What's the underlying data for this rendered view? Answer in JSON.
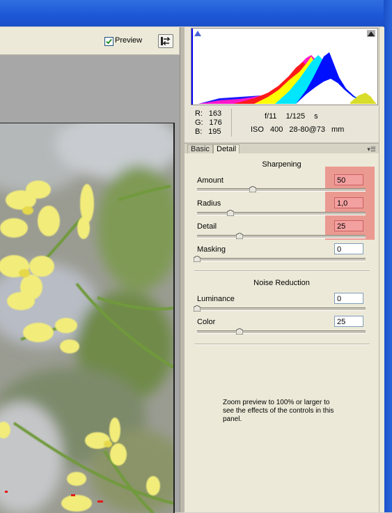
{
  "toolbar": {
    "preview_label": "Preview",
    "preview_checked": true,
    "toggle_icon": "swap-arrows-icon"
  },
  "readout": {
    "r_label": "R:",
    "r_value": "163",
    "g_label": "G:",
    "g_value": "176",
    "b_label": "B:",
    "b_value": "195",
    "aperture": "f/11",
    "shutter": "1/125 s",
    "iso": "ISO 400",
    "lens": "28-80@73 mm"
  },
  "tabs": [
    {
      "label": "Basic",
      "active": false
    },
    {
      "label": "Detail",
      "active": true
    }
  ],
  "sharpening": {
    "title": "Sharpening",
    "controls": [
      {
        "label": "Amount",
        "value": "50",
        "slider": 0.33,
        "highlighted": true
      },
      {
        "label": "Radius",
        "value": "1,0",
        "slider": 0.2,
        "highlighted": true
      },
      {
        "label": "Detail",
        "value": "25",
        "slider": 0.25,
        "highlighted": true
      },
      {
        "label": "Masking",
        "value": "0",
        "slider": 0.0,
        "highlighted": false
      }
    ]
  },
  "noise": {
    "title": "Noise Reduction",
    "controls": [
      {
        "label": "Luminance",
        "value": "0",
        "slider": 0.0
      },
      {
        "label": "Color",
        "value": "25",
        "slider": 0.25
      }
    ]
  },
  "note": "Zoom preview to 100% or larger to see the effects of the controls in this panel.",
  "colors": {
    "highlight": "#eb5a5a",
    "panel_bg": "#ece9d8",
    "titlebar": "#1c57d6"
  }
}
